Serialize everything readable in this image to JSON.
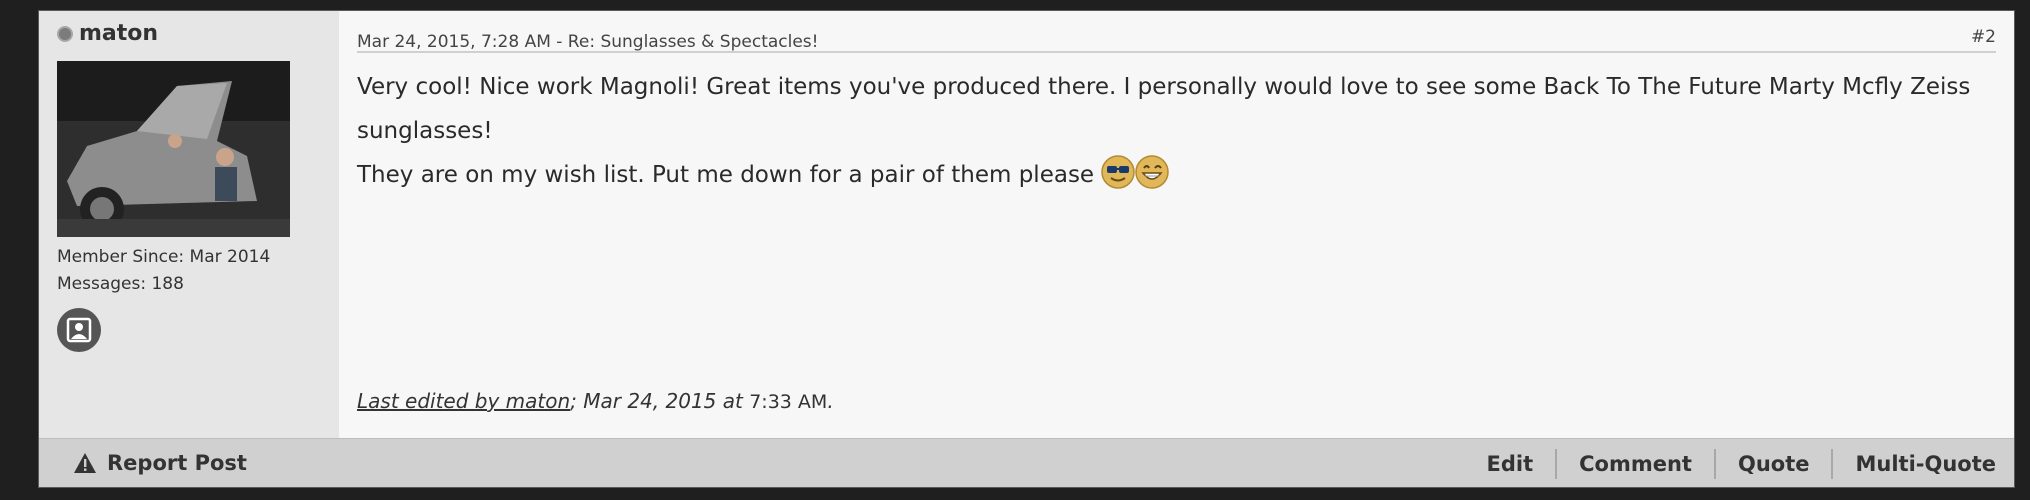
{
  "user": {
    "name": "maton",
    "member_since": "Member Since: Mar 2014",
    "messages": "Messages: 188"
  },
  "post": {
    "meta": "Mar 24, 2015, 7:28 AM - Re: Sunglasses & Spectacles!",
    "number": "#2",
    "body_line1": "Very cool! Nice work Magnoli! Great items you've produced there. I personally would love to see some Back To The Future Marty Mcfly Zeiss sunglasses!",
    "body_line2": "They are on my wish list. Put me down for a pair of them please ",
    "edited_by": "Last edited by maton",
    "edited_date": "; Mar 24, 2015 at ",
    "edited_time": "7:33 AM",
    "edited_end": "."
  },
  "footer": {
    "report": "Report Post",
    "actions": [
      "Edit",
      "Comment",
      "Quote",
      "Multi-Quote"
    ]
  },
  "icons": {
    "status": "offline-status-icon",
    "contact": "picture-icon",
    "report": "warning-icon",
    "smileys": [
      "cool-smiley-icon",
      "grin-smiley-icon"
    ]
  }
}
